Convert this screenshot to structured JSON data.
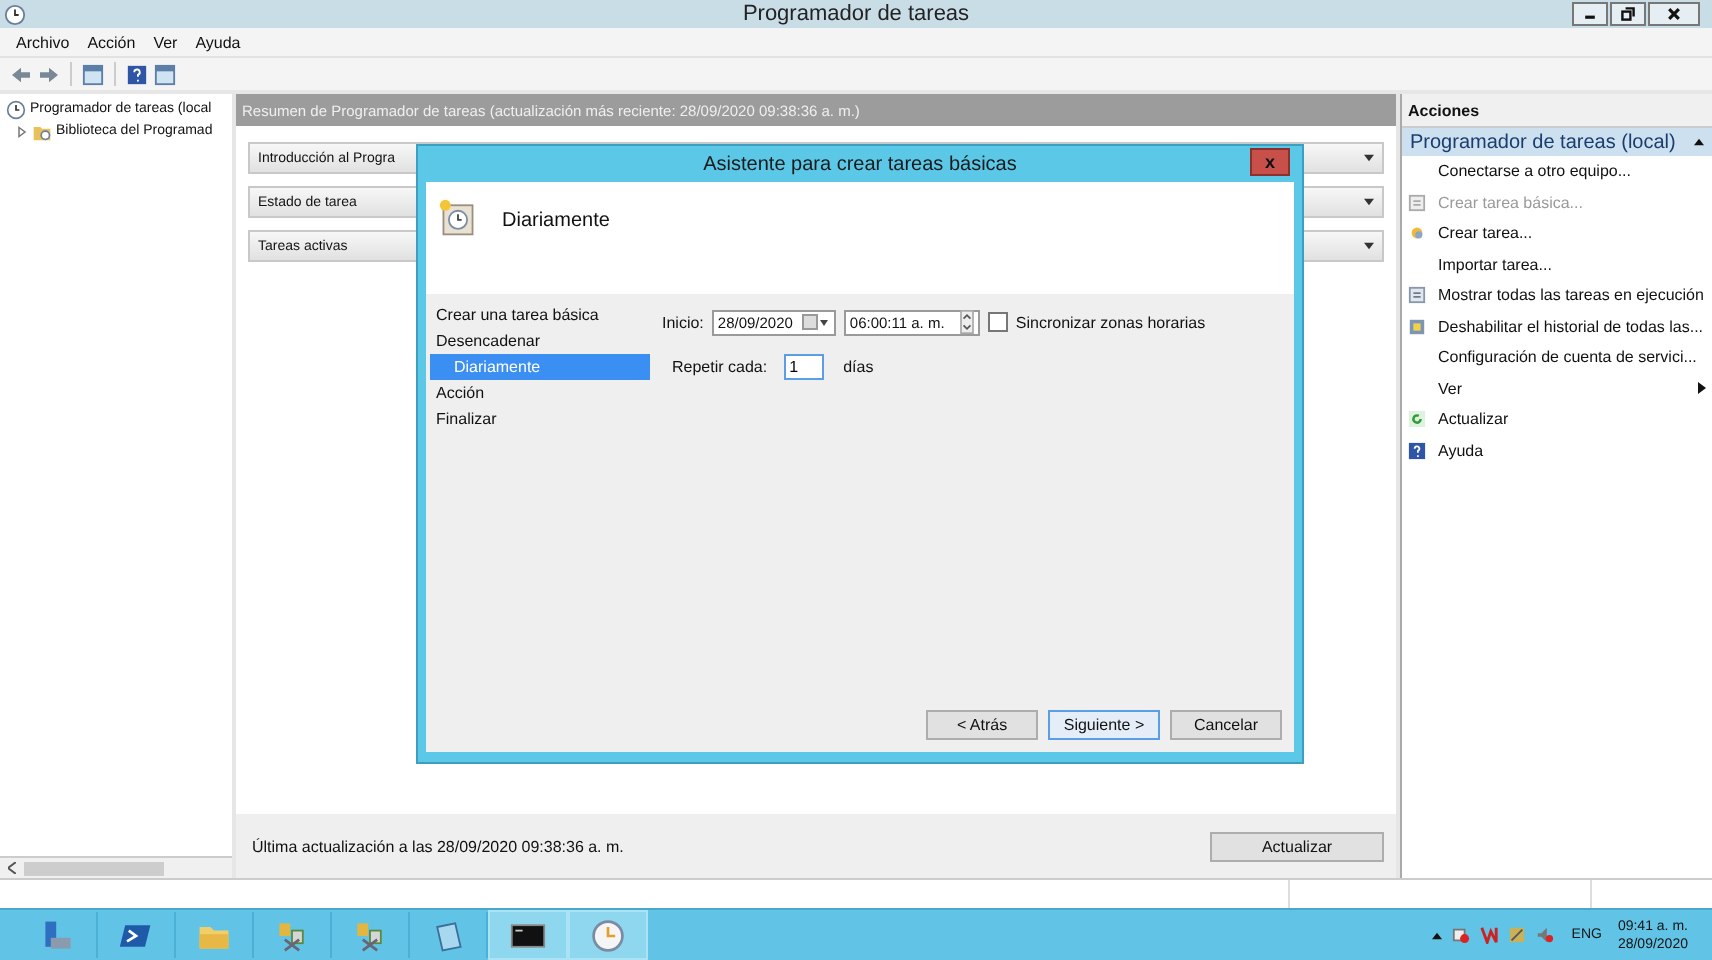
{
  "window": {
    "title": "Programador de tareas"
  },
  "menu": [
    "Archivo",
    "Acción",
    "Ver",
    "Ayuda"
  ],
  "tree": [
    {
      "label": "Programador de tareas (local",
      "children": [
        {
          "label": "Biblioteca del Programad",
          "expanded": false
        }
      ]
    }
  ],
  "summary": {
    "header": "Resumen de Programador de tareas (actualización más reciente: 28/09/2020 09:38:36 a. m.)",
    "sections": [
      {
        "label": "Introducción al Progra"
      },
      {
        "label": "Estado de tarea"
      },
      {
        "label": "Tareas activas"
      }
    ],
    "last_update": "Última actualización a las 28/09/2020 09:38:36 a. m.",
    "refresh_button": "Actualizar"
  },
  "dialog": {
    "title": "Asistente para crear tareas básicas",
    "close": "x",
    "header": "Diariamente",
    "steps": [
      {
        "label": "Crear una tarea básica",
        "selected": false
      },
      {
        "label": "Desencadenar",
        "selected": false,
        "children": [
          {
            "label": "Diariamente",
            "selected": true
          }
        ]
      },
      {
        "label": "Acción",
        "selected": false
      },
      {
        "label": "Finalizar",
        "selected": false
      }
    ],
    "start_label": "Inicio:",
    "date": "28/09/2020",
    "time": "06:00:11 a. m.",
    "sync": {
      "label": "Sincronizar zonas horarias",
      "checked": false
    },
    "repeat_label": "Repetir cada:",
    "repeat_value": "1",
    "repeat_unit": "días",
    "buttons": [
      {
        "label": "< Atrás",
        "focused": false
      },
      {
        "label": "Siguiente >",
        "focused": true
      },
      {
        "label": "Cancelar",
        "focused": false
      }
    ]
  },
  "actions": {
    "title": "Acciones",
    "group": "Programador de tareas (local)",
    "items": [
      {
        "label": "Conectarse a otro equipo...",
        "kind": "action",
        "disabled": false
      },
      {
        "label": "Crear tarea básica...",
        "kind": "action",
        "disabled": true
      },
      {
        "label": "Crear tarea...",
        "kind": "action",
        "disabled": false
      },
      {
        "label": "Importar tarea...",
        "kind": "action",
        "disabled": false
      },
      {
        "label": "Mostrar todas las tareas en ejecución",
        "kind": "action",
        "disabled": false
      },
      {
        "label": "Deshabilitar el historial de todas las...",
        "kind": "action",
        "disabled": false
      },
      {
        "label": "Configuración de cuenta de servici...",
        "kind": "action",
        "disabled": false
      },
      {
        "label": "Ver",
        "kind": "submenu",
        "disabled": false
      },
      {
        "label": "Actualizar",
        "kind": "action",
        "disabled": false
      },
      {
        "label": "Ayuda",
        "kind": "action",
        "disabled": false
      }
    ]
  },
  "taskbar": {
    "language": "ENG",
    "time": "09:41 a. m.",
    "date": "28/09/2020"
  }
}
